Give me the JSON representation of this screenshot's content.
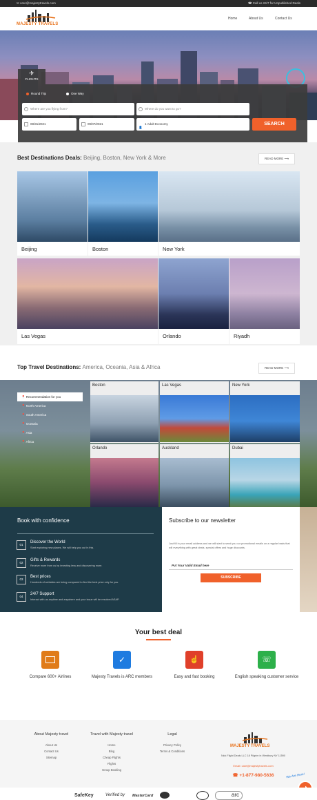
{
  "topbar": {
    "email": "care@majestytravels.com",
    "call": "Call us 24/7 for Unpublished Deals"
  },
  "header": {
    "logo_text": "MAJESTY TRAVELS",
    "nav": [
      "Home",
      "About Us",
      "Contact Us"
    ]
  },
  "search": {
    "tab": "FLIGHTS",
    "trip_options": [
      "Round Trip",
      "One Way"
    ],
    "from_placeholder": "Where are you flying from?",
    "to_placeholder": "Where do you want to go?",
    "depart": "08/31/2021",
    "return": "09/07/2021",
    "travelers": "1 Adult Economy",
    "button": "SEARCH"
  },
  "best_deals": {
    "title": "Best Destinations Deals:",
    "subtitle": "Beijing, Boston, New York & More",
    "read_more": "READ MORE",
    "cities": [
      "Beijing",
      "Boston",
      "New York",
      "Las Vegas",
      "Orlando",
      "Riyadh"
    ]
  },
  "top_destinations": {
    "title": "Top Travel Destinations:",
    "subtitle": "America, Oceania, Asia & Africa",
    "read_more": "READ MORE",
    "menu": [
      "Recommendation for you",
      "North America",
      "South America",
      "Oceania",
      "Asia",
      "Africa"
    ],
    "cities": [
      "Boston",
      "Las Vegas",
      "New York",
      "Orlando",
      "Auckland",
      "Dubai"
    ]
  },
  "confidence": {
    "title": "Book with confidence",
    "items": [
      {
        "num": "01",
        "head": "Discover the World",
        "desc": "Start exploring new places. We will help you out in this."
      },
      {
        "num": "02",
        "head": "Gifts & Rewards",
        "desc": "Receive more from us by investing less and discovering more."
      },
      {
        "num": "03",
        "head": "Best prices",
        "desc": "Hundreds of websites are being compared to find the best price only for you."
      },
      {
        "num": "04",
        "head": "24/7 Support",
        "desc": "Interact with us anytime and anywhere and your issue will be resolved ASAP."
      }
    ]
  },
  "newsletter": {
    "title": "Subscribe to our newsletter",
    "desc": "Just fill in your email address and we will start to send you our promotional emails on a regular basis that will everything with great deals, special offers and huge discounts.",
    "placeholder": "Put Your Valid Email here",
    "button": "SUBSCRIBE"
  },
  "best_deal": {
    "title": "Your best deal",
    "items": [
      "Compare 600+ Airlines",
      "Majesty Travels is ARC members",
      "Easy and fast booking",
      "English speaking customer service"
    ],
    "colors": [
      "#e07c1a",
      "#1e7be0",
      "#e0402a",
      "#2db04a"
    ]
  },
  "footer": {
    "col1": {
      "head": "About Majesty travel",
      "links": [
        "About Us",
        "Contact Us",
        "Sitemap"
      ]
    },
    "col2": {
      "head": "Travel with Majesty travel",
      "links": [
        "Home",
        "Blog",
        "Cheap Flights",
        "Flights",
        "Group Booking"
      ]
    },
    "col3": {
      "head": "Legal",
      "links": [
        "Privacy Policy",
        "Terms & Conditions"
      ]
    },
    "logo_text": "MAJESTY TRAVELS",
    "address": "Nick Flight Deals LLC 18 Pilgrim in Westbury NY 11590",
    "email": "care@majestytravels.com",
    "email_label": "Email:",
    "phone": "+1-877-980-5636",
    "chat": "We Are Here!"
  },
  "partners": [
    "SafeKey",
    "Verified by",
    "MasterCard",
    "Discover",
    "AMEX",
    "arc"
  ]
}
